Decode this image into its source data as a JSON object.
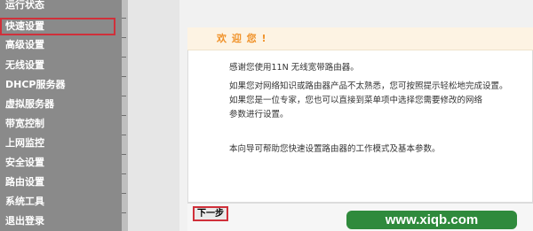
{
  "sidebar": {
    "items": [
      {
        "label": "运行状态",
        "selected": false
      },
      {
        "label": "快速设置",
        "selected": true
      },
      {
        "label": "高级设置",
        "selected": false
      },
      {
        "label": "无线设置",
        "selected": false
      },
      {
        "label": "DHCP服务器",
        "selected": false
      },
      {
        "label": "虚拟服务器",
        "selected": false
      },
      {
        "label": "带宽控制",
        "selected": false
      },
      {
        "label": "上网监控",
        "selected": false
      },
      {
        "label": "安全设置",
        "selected": false
      },
      {
        "label": "路由设置",
        "selected": false
      },
      {
        "label": "系统工具",
        "selected": false
      },
      {
        "label": "退出登录",
        "selected": false
      }
    ]
  },
  "main": {
    "welcome_title": "欢 迎 您 !",
    "paragraphs": [
      "感谢您使用11N 无线宽带路由器。",
      "如果您对网络知识或路由器产品不太熟悉，您可按照提示轻松地完成设置。",
      "如果您是一位专家，您也可以直接到菜单项中选择您需要修改的网络",
      "参数进行设置。",
      "本向导可帮助您快速设置路由器的工作模式及基本参数。"
    ],
    "next_button": "下一步"
  },
  "watermark": "www.xiqb.com",
  "colors": {
    "sidebar_bg": "#8a8a8a",
    "highlight": "#d0303a",
    "title": "#f0922a",
    "watermark_bg": "#2f8a3c"
  }
}
